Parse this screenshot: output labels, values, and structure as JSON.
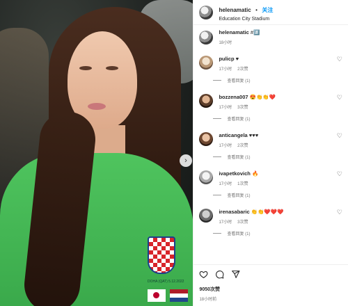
{
  "post": {
    "username": "helenamatic",
    "separator": "•",
    "follow_label": "关注",
    "location": "Education City Stadium"
  },
  "caption": {
    "username": "helenamatic",
    "text": "##️⃣",
    "time": "18小时"
  },
  "comments": [
    {
      "username": "pulicp",
      "text": "♥",
      "time": "17小时",
      "likes": "2次赞",
      "replies": "查看回复 (1)"
    },
    {
      "username": "bozzena007",
      "text": "😍👏👏❤️",
      "time": "17小时",
      "likes": "3次赞",
      "replies": "查看回复 (1)"
    },
    {
      "username": "anticangela",
      "text": "♥♥♥",
      "time": "17小时",
      "likes": "2次赞",
      "replies": "查看回复 (1)"
    },
    {
      "username": "ivapetkovich",
      "text": "🔥",
      "time": "17小时",
      "likes": "1次赞",
      "replies": "查看回复 (1)"
    },
    {
      "username": "irenasabaric",
      "text": "👏👏❤️❤️❤️",
      "time": "17小时",
      "likes": "3次赞",
      "replies": "查看回复 (1)"
    }
  ],
  "footer": {
    "likes": "9050次赞",
    "time": "18小时前"
  },
  "photo": {
    "shirt_text": "DOHA (QAT) 5.12.2022"
  },
  "icons": {
    "like": "heart-icon",
    "comment": "comment-icon",
    "share": "share-icon",
    "next": "chevron-right-icon"
  },
  "colors": {
    "accent": "#0095f6",
    "shirt": "#45b955"
  }
}
